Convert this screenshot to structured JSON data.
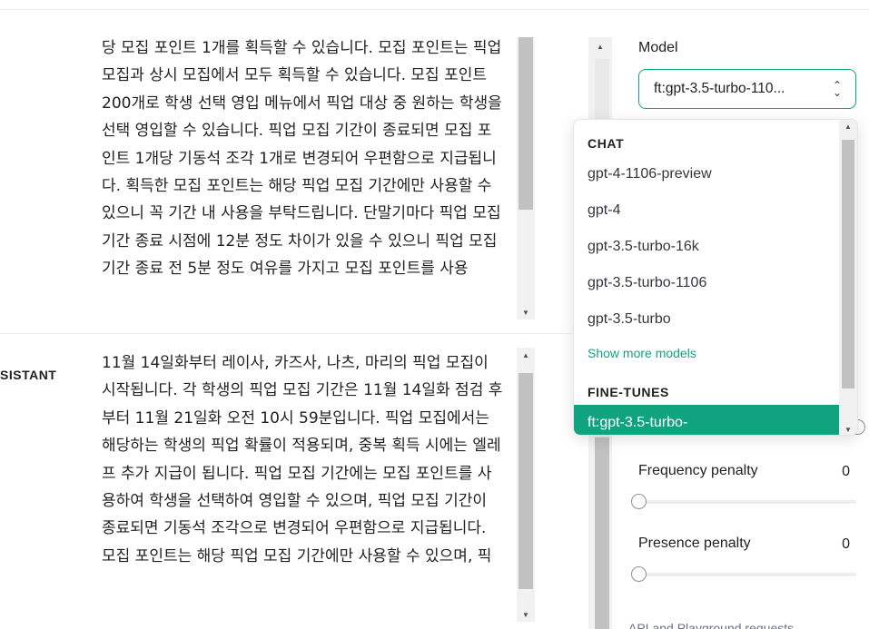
{
  "messages": {
    "first_text": "당 모집 포인트 1개를 획득할 수 있습니다. 모집 포인트는 픽업 모집과 상시 모집에서 모두 획득할 수 있습니다. 모집 포인트 200개로 학생 선택 영입 메뉴에서 픽업 대상 중 원하는 학생을 선택 영입할 수 있습니다. 픽업 모집 기간이 종료되면 모집 포인트 1개당 기동석 조각 1개로 변경되어 우편함으로 지급됩니다. 획득한 모집 포인트는 해당 픽업 모집 기간에만 사용할 수 있으니 꼭 기간 내 사용을 부탁드립니다. 단말기마다 픽업 모집 기간 종료 시점에 12분 정도 차이가 있을 수 있으니 픽업 모집 기간 종료 전 5분 정도 여유를 가지고 모집 포인트를 사용",
    "assistant_role": "SISTANT",
    "assistant_text": "11월 14일화부터 레이사, 카즈사, 나츠, 마리의 픽업 모집이 시작됩니다. 각 학생의 픽업 모집 기간은 11월 14일화 점검 후부터 11월 21일화 오전 10시 59분입니다. 픽업 모집에서는 해당하는 학생의 픽업 확률이 적용되며, 중복 획득 시에는 엘레프 추가 지급이 됩니다. 픽업 모집 기간에는 모집 포인트를 사용하여 학생을 선택하여 영입할 수 있으며, 픽업 모집 기간이 종료되면 기동석 조각으로 변경되어 우편함으로 지급됩니다. 모집 포인트는 해당 픽업 모집 기간에만 사용할 수 있으며, 픽"
  },
  "settings": {
    "model_label": "Model",
    "model_value": "ft:gpt-3.5-turbo-110...",
    "frequency_label": "Frequency penalty",
    "frequency_value": "0",
    "presence_label": "Presence penalty",
    "presence_value": "0",
    "bottom_hint": "API and Playground requests"
  },
  "dropdown": {
    "chat_heading": "CHAT",
    "chat_models": [
      "gpt-4-1106-preview",
      "gpt-4",
      "gpt-3.5-turbo-16k",
      "gpt-3.5-turbo-1106",
      "gpt-3.5-turbo"
    ],
    "show_more": "Show more models",
    "finetunes_heading": "FINE-TUNES",
    "selected_finetune": "ft:gpt-3.5-turbo-"
  },
  "icons": {
    "select_chevron": "chevron-up-down-icon",
    "scroll_up": "triangle-up-icon",
    "scroll_down": "triangle-down-icon"
  },
  "colors": {
    "accent": "#10a37f",
    "text": "#202123",
    "scrollbar_thumb": "#c1c1c1"
  }
}
